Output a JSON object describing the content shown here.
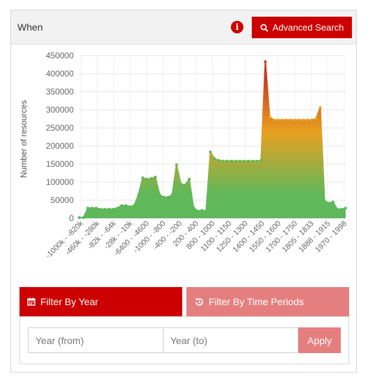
{
  "header": {
    "title": "When",
    "info_icon_glyph": "i",
    "advanced_search_label": "Advanced Search",
    "accent_color": "#cc0000"
  },
  "chart_data": {
    "type": "area",
    "ylabel": "Number of resources",
    "xlabel": "",
    "ylim": [
      0,
      450000
    ],
    "yticks": [
      0,
      50000,
      100000,
      150000,
      200000,
      250000,
      300000,
      350000,
      400000,
      450000
    ],
    "ytick_labels": [
      "0",
      "50000",
      "100000",
      "150000",
      "200000",
      "250000",
      "300000",
      "350000",
      "400000",
      "450000"
    ],
    "x_tick_labels": [
      "-1000k - -820k",
      "-460k - -280k",
      "-82k - -64k",
      "-28k - -10k",
      "-6400 - -4600",
      "-1000 - -800",
      "-400 - -200",
      "200 - 400",
      "800 - 1000",
      "1100 - 1150",
      "1250 - 1300",
      "1400 - 1450",
      "1550 - 1600",
      "1700 - 1750",
      "1805 - 1833",
      "1888 - 1915",
      "1970 - 1998"
    ],
    "values": [
      2000,
      2000,
      28000,
      28000,
      28000,
      25000,
      25000,
      25000,
      25000,
      28000,
      35000,
      35000,
      32000,
      35000,
      65000,
      112000,
      108000,
      110000,
      114000,
      65000,
      58000,
      58000,
      65000,
      148000,
      95000,
      92000,
      108000,
      30000,
      20000,
      22000,
      20000,
      183000,
      165000,
      160000,
      158000,
      158000,
      158000,
      158000,
      158000,
      158000,
      158000,
      158000,
      158000,
      160000,
      433000,
      280000,
      272000,
      272000,
      272000,
      272000,
      272000,
      272000,
      272000,
      272000,
      272000,
      272000,
      275000,
      306000,
      48000,
      42000,
      45000,
      25000,
      25000,
      28000
    ],
    "gradient_colors": [
      "#c93a1f",
      "#e8a020",
      "#5fb85a"
    ],
    "grid": true
  },
  "filters": {
    "tab_year_label": "Filter By Year",
    "tab_periods_label": "Filter By Time Periods",
    "year_from_placeholder": "Year (from)",
    "year_to_placeholder": "Year (to)",
    "apply_label": "Apply"
  }
}
